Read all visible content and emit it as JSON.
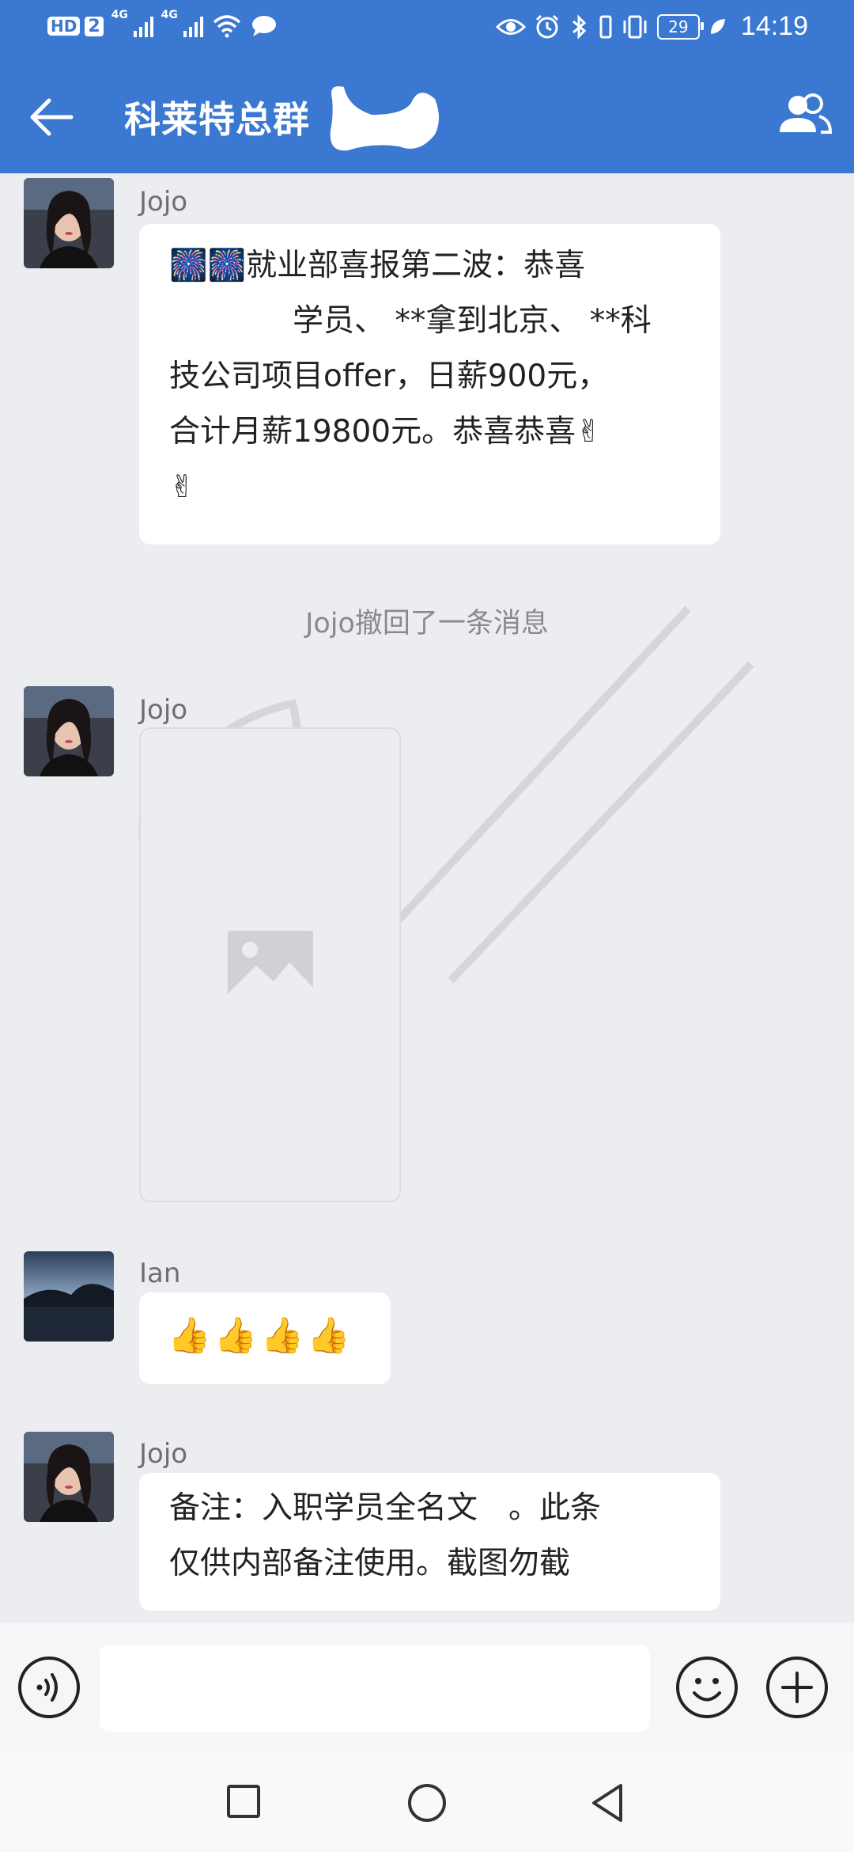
{
  "status_bar": {
    "hd_label": "HD",
    "sim_label": "2",
    "network_label_1": "4G",
    "network_label_2": "4G",
    "battery": "29",
    "time": "14:19"
  },
  "header": {
    "title": "科莱特总群"
  },
  "messages": [
    {
      "sender": "Jojo",
      "lines": [
        "🎆🎆就业部喜报第二波：恭喜",
        "　　　　学员、 **拿到北京、 **科",
        "技公司项目offer，日薪900元，",
        "合计月薪19800元。恭喜恭喜✌",
        "✌"
      ]
    },
    {
      "system": "Jojo撤回了一条消息"
    },
    {
      "sender": "Jojo",
      "image_icon": "image-placeholder-icon"
    },
    {
      "sender": "Ian",
      "text": "👍👍👍👍"
    },
    {
      "sender": "Jojo",
      "lines": [
        "备注：入职学员全名文　。此条",
        "仅供内部备注使用。截图勿截"
      ]
    }
  ],
  "input": {
    "placeholder": ""
  },
  "colors": {
    "header": "#3b78d1",
    "chat_bg": "#ebedf1",
    "bubble": "#ffffff"
  },
  "icons": {
    "back": "arrow-left-icon",
    "members": "group-members-icon",
    "voice": "voice-icon",
    "emoji": "smiley-icon",
    "plus": "plus-icon",
    "nav_recent": "square-icon",
    "nav_home": "circle-icon",
    "nav_back": "triangle-icon"
  }
}
